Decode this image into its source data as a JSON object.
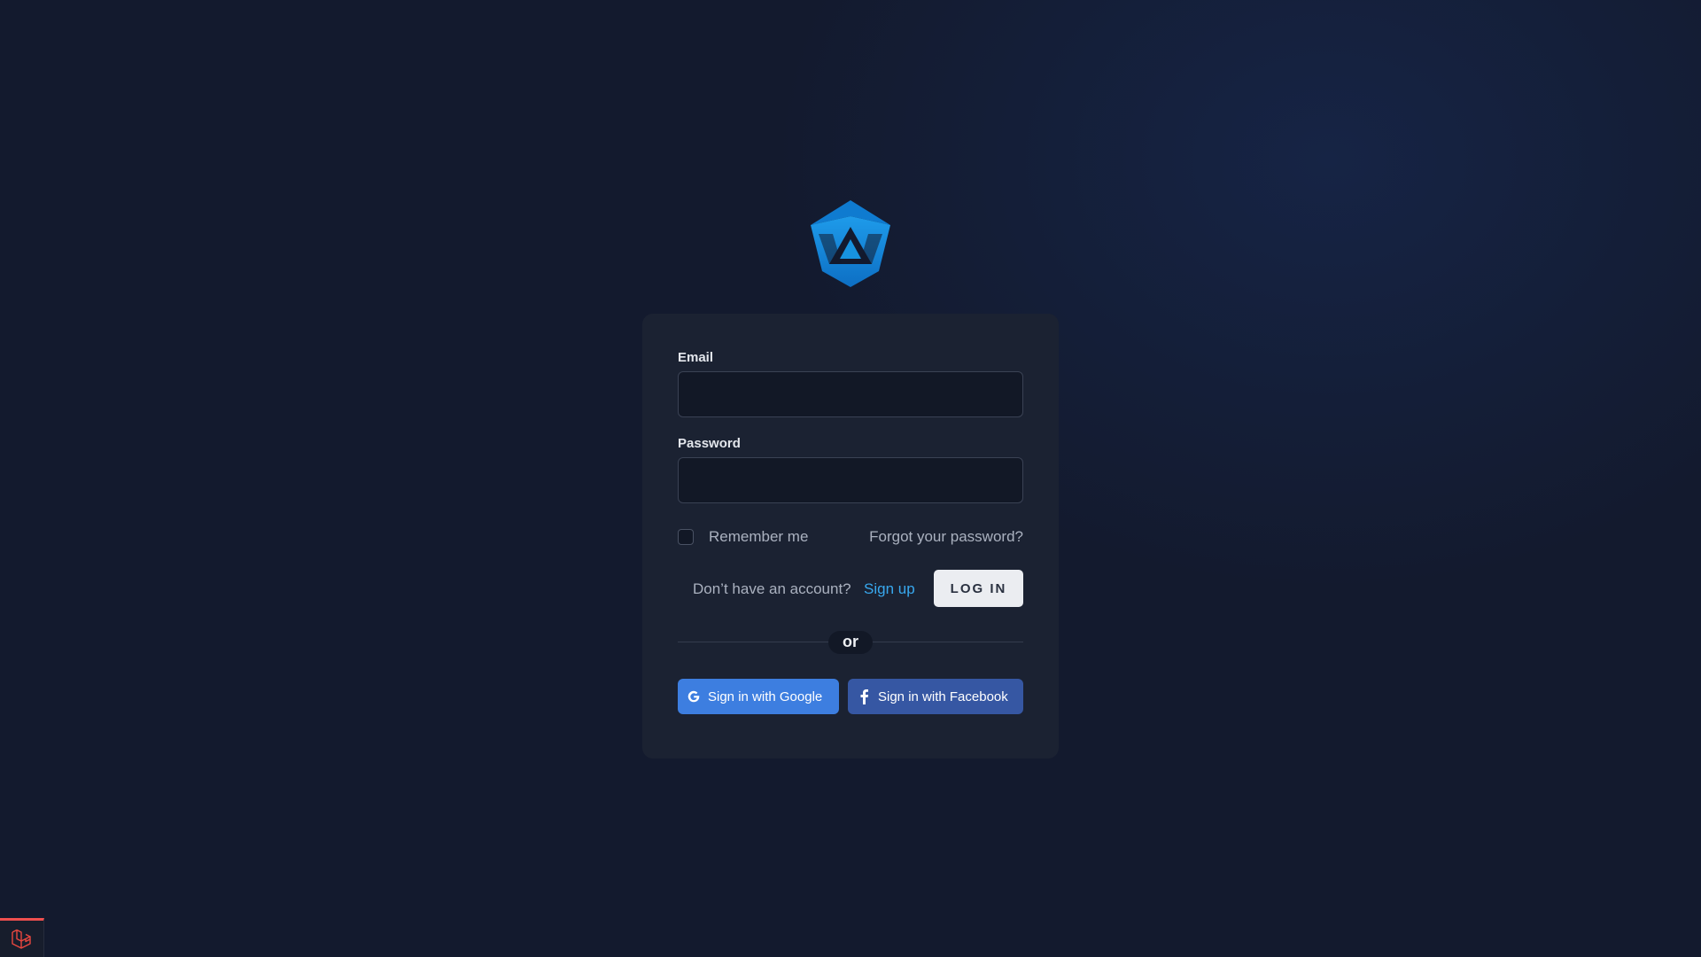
{
  "login_form": {
    "email_label": "Email",
    "email_value": "",
    "password_label": "Password",
    "password_value": "",
    "remember_label": "Remember me",
    "remember_checked": false,
    "forgot_password": "Forgot your password?",
    "signup_prompt": "Don’t have an account?",
    "signup_link": "Sign up",
    "login_button": "LOG IN",
    "divider_text": "or"
  },
  "social": {
    "google_label": "Sign in with Google",
    "facebook_label": "Sign in with Facebook"
  },
  "icons": {
    "logo": "crown-logo",
    "google": "google-g-icon",
    "facebook": "facebook-f-icon",
    "debug": "laravel-icon"
  },
  "colors": {
    "background": "#131a2e",
    "card": "#1b2232",
    "accent_link": "#38a8ee",
    "google": "#3d7ee0",
    "facebook": "#3657a3",
    "logo_blue": "#1793e0"
  }
}
